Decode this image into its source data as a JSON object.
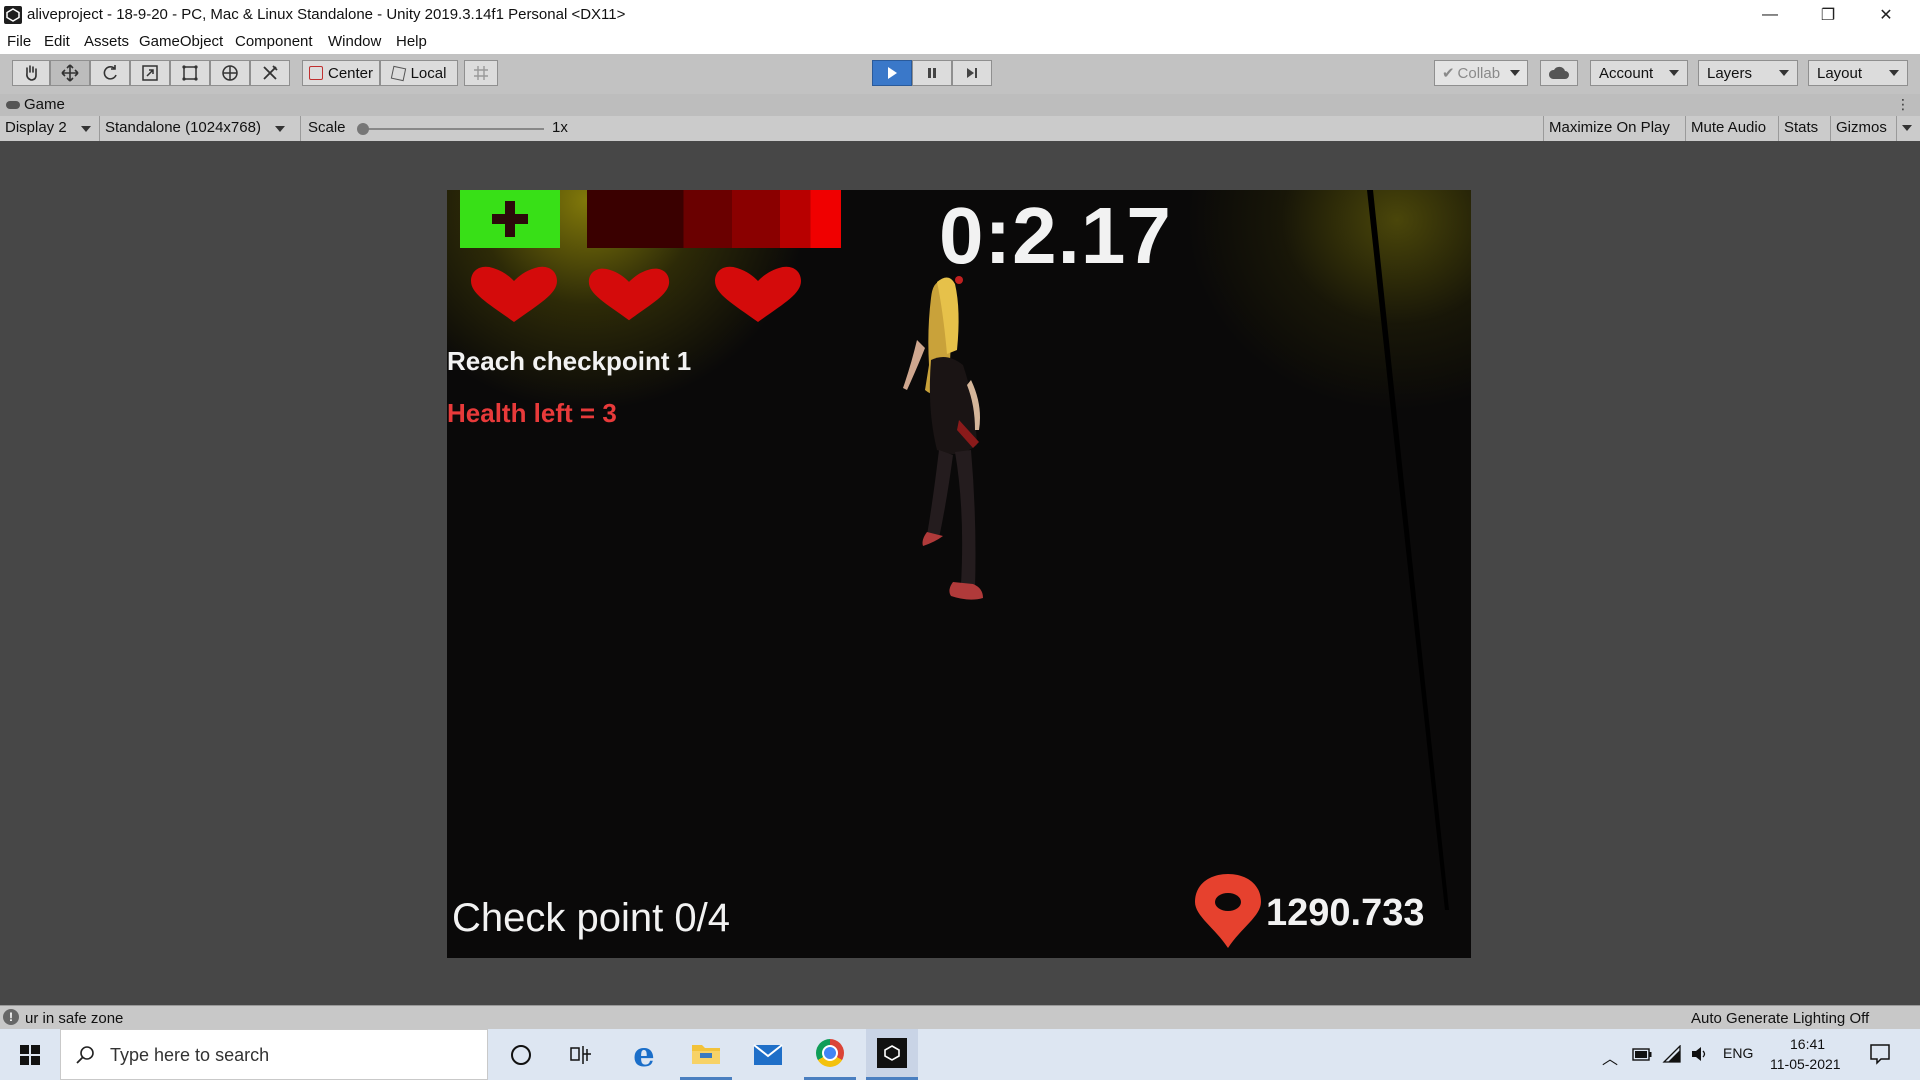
{
  "window": {
    "title": "aliveproject - 18-9-20 - PC, Mac & Linux Standalone - Unity 2019.3.14f1 Personal <DX11>",
    "minimize": "—",
    "restore": "❐",
    "close": "✕"
  },
  "menu": [
    "File",
    "Edit",
    "Assets",
    "GameObject",
    "Component",
    "Window",
    "Help"
  ],
  "toolbar": {
    "pivot": "Center",
    "space": "Local",
    "collab": "Collab",
    "account": "Account",
    "layers": "Layers",
    "layout": "Layout"
  },
  "game_tab": {
    "label": "Game",
    "display": "Display 2",
    "resolution": "Standalone (1024x768)",
    "scale_label": "Scale",
    "scale_value": "1x",
    "maximize_on_play": "Maximize On Play",
    "mute_audio": "Mute Audio",
    "stats": "Stats",
    "gizmos": "Gizmos"
  },
  "hud": {
    "timer": "0:2.17",
    "objective": "Reach checkpoint 1",
    "health_text": "Health left = 3",
    "checkpoint": "Check point 0/4",
    "distance": "1290.733",
    "hearts": 3
  },
  "status": {
    "message": "ur in safe zone",
    "lighting": "Auto Generate Lighting Off"
  },
  "taskbar": {
    "search_placeholder": "Type here to search",
    "language": "ENG",
    "time": "16:41",
    "date": "11-05-2021"
  },
  "colors": {
    "accent_play": "#3a78c9",
    "health_text": "#e83a3a",
    "heal_button": "#38e017",
    "map_pin": "#e6412e"
  }
}
